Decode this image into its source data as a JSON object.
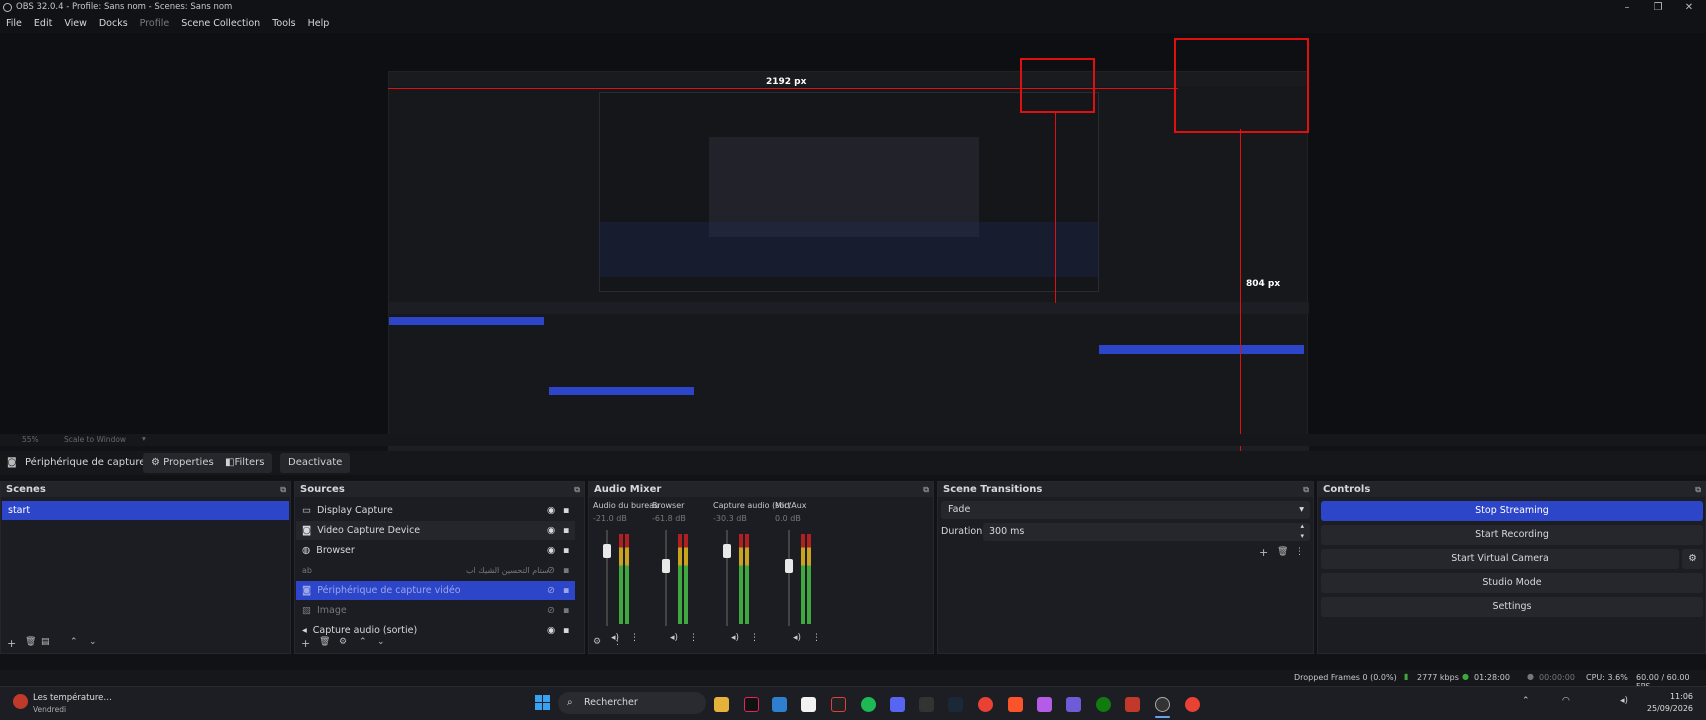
{
  "window": {
    "title": "OBS 32.0.4 - Profile: Sans nom - Scenes: Sans nom",
    "minimize": "–",
    "maximize": "❐",
    "close": "✕"
  },
  "menu": [
    "File",
    "Edit",
    "View",
    "Docks",
    "Profile",
    "Scene Collection",
    "Tools",
    "Help"
  ],
  "preview": {
    "dim_w": "2192 px",
    "dim_h": "804 px"
  },
  "preview_status": {
    "zoom": "55%",
    "scale": "Scale to Window"
  },
  "toolbar": {
    "source_name": "Périphérique de capture vi",
    "properties": "Properties",
    "filters": "Filters",
    "deactivate": "Deactivate"
  },
  "scenes": {
    "title": "Scenes",
    "items": [
      "start"
    ]
  },
  "sources": {
    "title": "Sources",
    "items": [
      "Display Capture",
      "Video Capture Device",
      "Browser",
      "ستام التحسين الشيك اب",
      "Périphérique de capture vidéo",
      "Image",
      "Capture audio (sortie)"
    ]
  },
  "mixer": {
    "title": "Audio Mixer",
    "channels": [
      {
        "name": "Audio du bureau",
        "db": "-21.0 dB"
      },
      {
        "name": "Browser",
        "db": "-61.8 dB"
      },
      {
        "name": "Capture audio (sort",
        "db": "-30.3 dB"
      },
      {
        "name": "Mic/Aux",
        "db": "0.0 dB"
      }
    ]
  },
  "transitions": {
    "title": "Scene Transitions",
    "selected": "Fade",
    "duration_label": "Duration",
    "duration_value": "300 ms"
  },
  "controls": {
    "title": "Controls",
    "buttons": [
      "Stop Streaming",
      "Start Recording",
      "Start Virtual Camera",
      "Studio Mode",
      "Settings"
    ]
  },
  "statusbar": {
    "dropped": "Dropped Frames 0 (0.0%)",
    "kbps": "2777 kbps",
    "stream_time": "01:28:00",
    "rec_time": "00:00:00",
    "cpu": "CPU: 3.6%",
    "fps": "60.00 / 60.00 FPS"
  },
  "taskbar": {
    "weather": "Les température…",
    "weather_sub": "Vendredi",
    "search": "Rechercher",
    "time": "11:06",
    "date": "25/09/2026"
  },
  "colors": {
    "accent": "#2d45c9",
    "red_guides": "#e01010"
  }
}
